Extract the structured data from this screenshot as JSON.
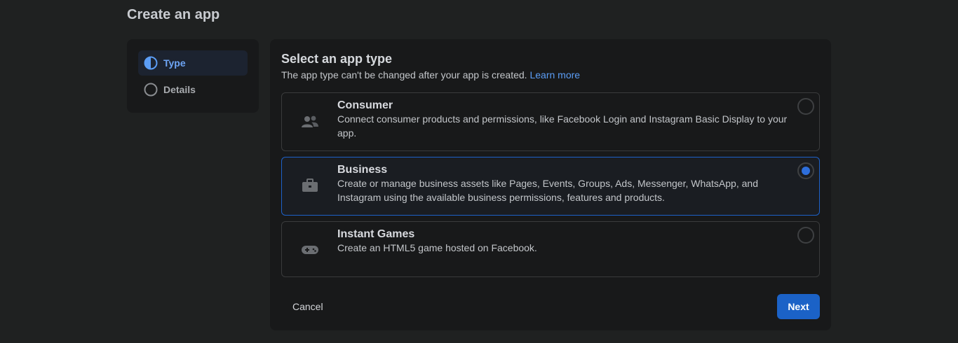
{
  "page": {
    "title": "Create an app"
  },
  "steps": [
    {
      "label": "Type",
      "state": "active",
      "icon": "half-circle-icon"
    },
    {
      "label": "Details",
      "state": "inactive",
      "icon": "empty-circle-icon"
    }
  ],
  "main": {
    "title": "Select an app type",
    "subtitle": "The app type can't be changed after your app is created.",
    "learn_more": "Learn more"
  },
  "options": [
    {
      "title": "Consumer",
      "description": "Connect consumer products and permissions, like Facebook Login and Instagram Basic Display to your app.",
      "icon": "people-icon",
      "selected": false
    },
    {
      "title": "Business",
      "description": "Create or manage business assets like Pages, Events, Groups, Ads, Messenger, WhatsApp, and Instagram using the available business permissions, features and products.",
      "icon": "briefcase-icon",
      "selected": true
    },
    {
      "title": "Instant Games",
      "description": "Create an HTML5 game hosted on Facebook.",
      "icon": "gamepad-icon",
      "selected": false
    }
  ],
  "actions": {
    "cancel": "Cancel",
    "next": "Next"
  },
  "colors": {
    "accent": "#1b62c7",
    "link": "#5b9df5",
    "background": "#1f2121",
    "panel": "#18191a"
  }
}
